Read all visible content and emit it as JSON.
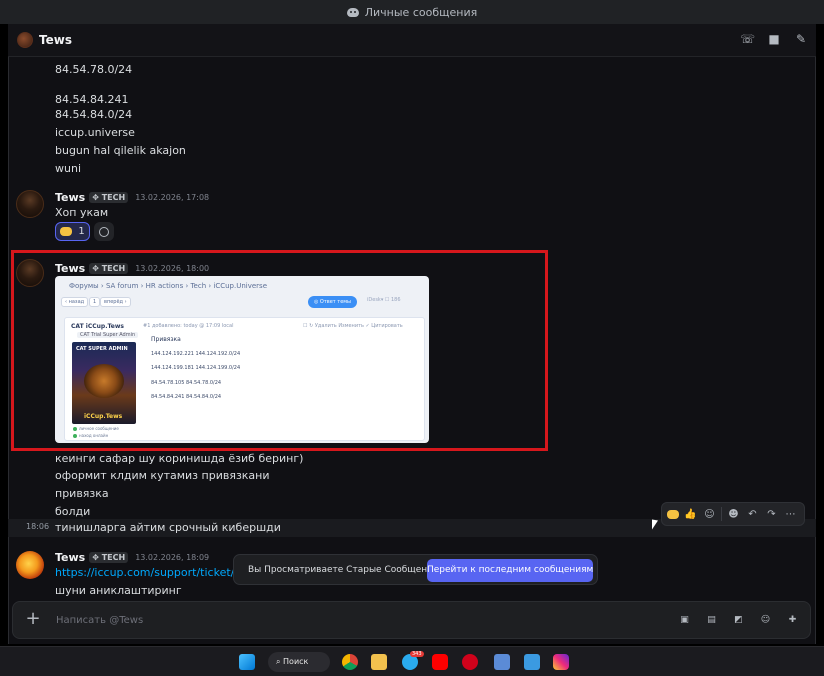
{
  "window": {
    "title": "Личные сообщения"
  },
  "channel": {
    "name": "Tews"
  },
  "header_icons": [
    "phone-icon",
    "video-icon",
    "pin-icon"
  ],
  "messages_top": [
    "84.54.78.0/24",
    "84.54.84.241",
    "84.54.84.0/24",
    "iccup.universe",
    "bugun hal qilelik akajon",
    "wuni"
  ],
  "msg1": {
    "author": "Tews",
    "tag": "✥ TECH",
    "time": "13.02.2026, 17:08",
    "text": "Хоп укам",
    "reaction_count": "1"
  },
  "msg2": {
    "author": "Tews",
    "tag": "✥ TECH",
    "time": "13.02.2026, 18:00",
    "lines": [
      "кеинги сафар шу коринишда ёзиб беринг)",
      "оформит клдим кутамиз привязкани",
      "привязка",
      "болди"
    ],
    "hover_time": "18:06",
    "hover_text": "тинишларга айтим срочный кибершди"
  },
  "embed": {
    "breadcrumb": "Форумы  ›  SA forum  ›  HR actions  ›  Tech  ›  iCCup.Universe",
    "btn_prev": "‹ назад",
    "btn_page": "1",
    "btn_next": "вперёд ›",
    "btn_reply": "◎ Ответ темы",
    "tb_right": "iDesk▾    ☐ 186",
    "author": "CAT iCCup.Tews",
    "meta": "#1 добавлено: today @ 17:09 local",
    "actions": "☐   ↻   Удалить   Изменить   ✓ Цитировать",
    "role": "CAT Trial Super Admin",
    "card_top": "CAT SUPER ADMIN",
    "card_bottom": "iCCup.Tews",
    "title": "Привязка",
    "ips": [
      "144.124.192.221 144.124.192.0/24",
      "144.124.199.181 144.124.199.0/24",
      "84.54.78.105 84.54.78.0/24",
      "84.54.84.241 84.54.84.0/24"
    ],
    "side": [
      "личное сообщение",
      "наход онлайн"
    ]
  },
  "msg3": {
    "author": "Tews",
    "tag": "✥ TECH",
    "time": "13.02.2026, 18:09",
    "link": "https://iccup.com/support/ticket/1924",
    "text": "шуни аниклаштиринг"
  },
  "banner": {
    "text": "Вы Просматриваете Старые Сообщения",
    "button": "Перейти к последним сообщениям"
  },
  "composer": {
    "placeholder": "Написать @Tews"
  },
  "taskbar": {
    "search": "Поиск",
    "telegram_badge": "343"
  },
  "colors": {
    "accent": "#5865f2",
    "highlight": "#d6171c",
    "link": "#00a8fc"
  }
}
